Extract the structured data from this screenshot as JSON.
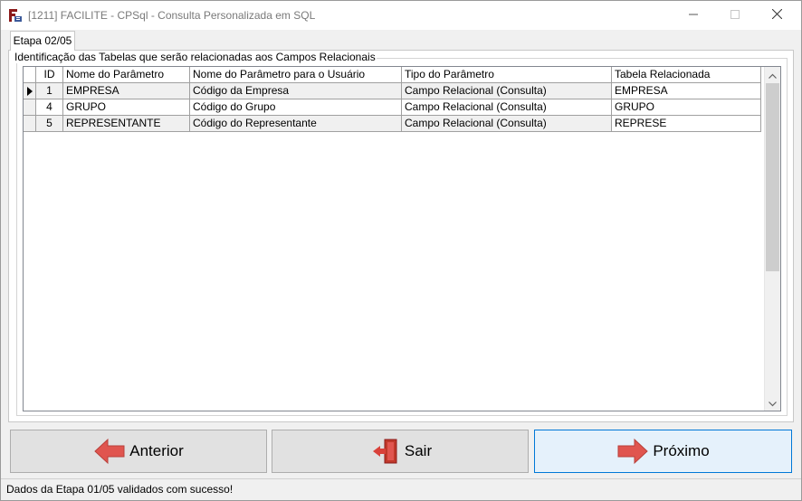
{
  "window": {
    "title": "[1211] FACILITE - CPSql - Consulta Personalizada em SQL"
  },
  "tab": {
    "label": "Etapa 02/05"
  },
  "group": {
    "legend": "Identificação das Tabelas que serão relacionadas aos Campos Relacionais"
  },
  "grid": {
    "columns": [
      "ID",
      "Nome do Parâmetro",
      "Nome do Parâmetro para o Usuário",
      "Tipo do Parâmetro",
      "Tabela Relacionada"
    ],
    "rows": [
      {
        "id": "1",
        "nome": "EMPRESA",
        "usuario": "Código da Empresa",
        "tipo": "Campo Relacional (Consulta)",
        "tabela": "EMPRESA"
      },
      {
        "id": "4",
        "nome": "GRUPO",
        "usuario": "Código do Grupo",
        "tipo": "Campo Relacional (Consulta)",
        "tabela": "GRUPO"
      },
      {
        "id": "5",
        "nome": "REPRESENTANTE",
        "usuario": "Código do Representante",
        "tipo": "Campo Relacional (Consulta)",
        "tabela": "REPRESE"
      }
    ]
  },
  "buttons": {
    "anterior": "Anterior",
    "sair": "Sair",
    "proximo": "Próximo"
  },
  "status": {
    "text": "Dados da Etapa 01/05 validados com sucesso!"
  },
  "colors": {
    "arrow_red": "#e0554f",
    "door_red": "#c0392b",
    "primary_border": "#0078d7"
  },
  "icons": {
    "app": "facilite-app-icon",
    "anterior": "arrow-left-icon",
    "sair": "exit-door-icon",
    "proximo": "arrow-right-icon"
  }
}
